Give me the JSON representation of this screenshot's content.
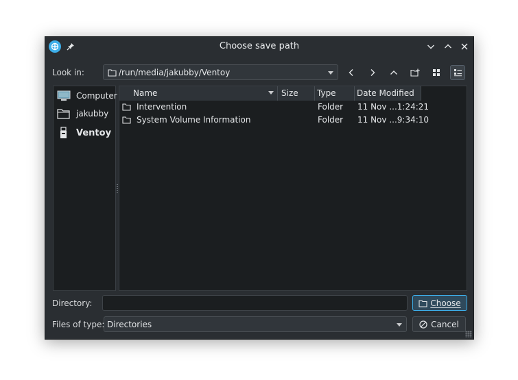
{
  "window": {
    "title": "Choose save path"
  },
  "lookin": {
    "label": "Look in:",
    "path": "/run/media/jakubby/Ventoy"
  },
  "toolbar": [
    "back-icon",
    "forward-icon",
    "parent-folder-icon",
    "new-folder-icon",
    "icon-view-icon",
    "detail-view-icon"
  ],
  "places": [
    {
      "label": "Computer",
      "icon": "computer-icon"
    },
    {
      "label": "jakubby",
      "icon": "home-folder-icon"
    },
    {
      "label": "Ventoy",
      "icon": "usb-drive-icon",
      "selected": true
    }
  ],
  "columns": {
    "name": "Name",
    "size": "Size",
    "type": "Type",
    "modified": "Date Modified"
  },
  "files": [
    {
      "name": "Intervention",
      "size": "",
      "type": "Folder",
      "modified": "11 Nov ...1:24:21"
    },
    {
      "name": "System Volume Information",
      "size": "",
      "type": "Folder",
      "modified": "11 Nov ...9:34:10"
    }
  ],
  "directory": {
    "label": "Directory:",
    "value": ""
  },
  "filetype": {
    "label": "Files of type:",
    "value": "Directories"
  },
  "buttons": {
    "choose": "Choose",
    "cancel": "Cancel"
  },
  "colors": {
    "accent": "#3daee9",
    "window_bg": "#2a2e32",
    "view_bg": "#1b1e20"
  }
}
